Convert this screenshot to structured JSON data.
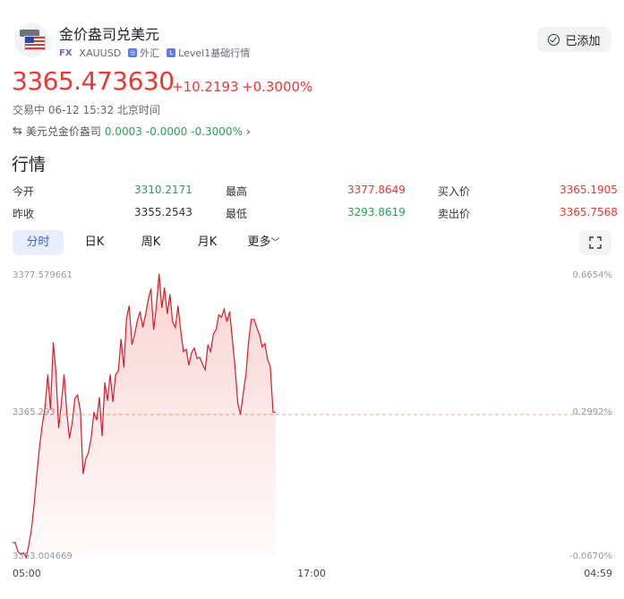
{
  "header": {
    "title": "金价盎司兑美元",
    "tag_fx": "FX",
    "symbol": "XAUUSD",
    "market": "外汇",
    "level": "Level1基础行情",
    "added_label": "已添加"
  },
  "quote": {
    "price": "3365.473630",
    "change": "+10.2193",
    "change_pct": "+0.3000%",
    "status": "交易中 06-12 15:32 北京时间"
  },
  "inverse": {
    "label": "美元兑金价盎司",
    "price": "0.0003",
    "change": "-0.0000",
    "change_pct": "-0.3000%"
  },
  "section_title": "行情",
  "stats": {
    "open_label": "今开",
    "open": "3310.2171",
    "high_label": "最高",
    "high": "3377.8649",
    "bid_label": "买入价",
    "bid": "3365.1905",
    "prev_label": "昨收",
    "prev": "3355.2543",
    "low_label": "最低",
    "low": "3293.8619",
    "ask_label": "卖出价",
    "ask": "3365.7568"
  },
  "tabs": [
    "分时",
    "日K",
    "周K",
    "月K",
    "更多"
  ],
  "active_tab": "分时",
  "colors": {
    "up": "#e53935",
    "down": "#2a9d59",
    "accent": "#3a66d6"
  },
  "chart_data": {
    "type": "line",
    "y_labels": {
      "top": "3377.579661",
      "mid": "3365.293",
      "bottom": "3353.004669"
    },
    "pct_labels": {
      "top": "0.6654%",
      "mid": "0.2992%",
      "bottom": "-0.0670%"
    },
    "x_labels": [
      "05:00",
      "17:00",
      "04:59"
    ],
    "reference_price": 3365.29,
    "ylim": [
      3353.004669,
      3377.579661
    ],
    "series": [
      {
        "values": [
          3354.1,
          3354.1,
          3353.3,
          3353.1,
          3353.2,
          3352.8,
          3353.9,
          3355.3,
          3357.5,
          3360.2,
          3362.6,
          3364.4,
          3366.0,
          3368.8,
          3365.7,
          3371.6,
          3369.0,
          3364.1,
          3366.3,
          3368.8,
          3365.5,
          3363.2,
          3364.6,
          3366.7,
          3367.0,
          3365.6,
          3360.1,
          3361.4,
          3362.0,
          3363.3,
          3365.5,
          3364.8,
          3366.8,
          3363.4,
          3368.1,
          3366.5,
          3368.8,
          3366.4,
          3368.8,
          3369.1,
          3371.9,
          3369.4,
          3373.7,
          3374.8,
          3371.4,
          3372.3,
          3373.5,
          3374.3,
          3372.9,
          3374.0,
          3375.3,
          3376.3,
          3372.7,
          3374.7,
          3377.6,
          3374.6,
          3376.4,
          3374.1,
          3375.8,
          3373.4,
          3372.9,
          3374.8,
          3372.6,
          3370.8,
          3371.0,
          3369.6,
          3370.7,
          3371.1,
          3370.2,
          3370.3,
          3369.7,
          3369.2,
          3371.4,
          3370.8,
          3372.3,
          3372.7,
          3374.0,
          3373.8,
          3374.5,
          3373.4,
          3374.3,
          3371.9,
          3369.5,
          3366.3,
          3365.3,
          3367.1,
          3368.8,
          3371.7,
          3373.6,
          3373.6,
          3372.9,
          3372.3,
          3371.2,
          3371.5,
          3370.1,
          3369.5,
          3365.5,
          3365.5
        ]
      }
    ]
  }
}
